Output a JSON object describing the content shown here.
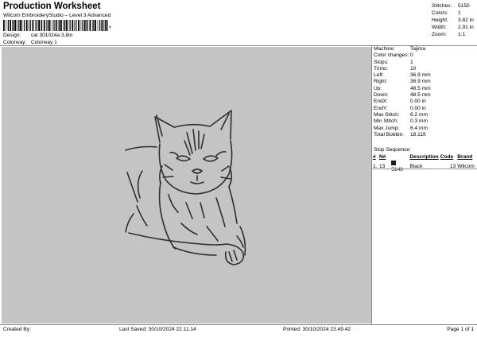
{
  "header": {
    "title": "Production Worksheet",
    "subtitle": "Wilcom EmbroideryStudio – Level 3 Advanced",
    "barcode_text": ",",
    "design_label": "Design:",
    "design_value": "cat 301024a 3,8in",
    "colorway_label": "Colorway:",
    "colorway_value": "Colorway 1"
  },
  "top_stats": [
    {
      "label": "Stitches:",
      "value": "5150"
    },
    {
      "label": "Colors:",
      "value": "1"
    },
    {
      "label": "Height:",
      "value": "3.82 in"
    },
    {
      "label": "Width:",
      "value": "2.91 in"
    },
    {
      "label": "Zoom:",
      "value": "1:1"
    }
  ],
  "info": [
    {
      "label": "Machine:",
      "value": "Tajima"
    },
    {
      "label": "Color changes:",
      "value": "0"
    },
    {
      "label": "Stops:",
      "value": "1"
    },
    {
      "label": "Trims:",
      "value": "10"
    },
    {
      "label": "Left:",
      "value": "36.9 mm"
    },
    {
      "label": "Right:",
      "value": "36.9 mm"
    },
    {
      "label": "Up:",
      "value": "48.5 mm"
    },
    {
      "label": "Down:",
      "value": "48.5 mm"
    },
    {
      "label": "EndX:",
      "value": "0.00 in"
    },
    {
      "label": "EndY:",
      "value": "0.00 in"
    },
    {
      "label": "Max Stitch:",
      "value": "6.2 mm"
    },
    {
      "label": "Min Stitch:",
      "value": "0.3 mm"
    },
    {
      "label": "Max Jump:",
      "value": "6.4 mm"
    },
    {
      "label": "Total Bobbin:",
      "value": "18.11ft"
    }
  ],
  "stop_sequence": {
    "title": "Stop Sequence:",
    "headers": [
      "#",
      "N#",
      "",
      "Description",
      "Code",
      "Brand"
    ],
    "rows": [
      {
        "index": "1.",
        "stop": "13",
        "thread": "5148",
        "description": "Black",
        "code": "13",
        "brand": "Wilcom",
        "color": "#1a1a1a"
      }
    ]
  },
  "canvas": {
    "background": "#c4c4c4",
    "stroke_color": "#2e2e2e"
  },
  "footer": {
    "created_by": "Created By:",
    "last_saved": "Last Saved: 30/10/2024 22.11.14",
    "printed": "Printed: 30/10/2024 23.49.42",
    "page": "Page 1 of 1"
  }
}
